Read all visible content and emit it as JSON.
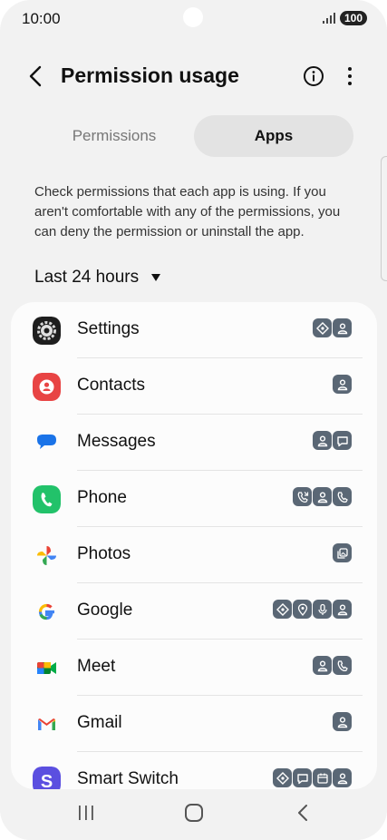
{
  "status": {
    "time": "10:00",
    "battery": "100"
  },
  "appbar": {
    "title": "Permission usage"
  },
  "tabs": [
    {
      "label": "Permissions"
    },
    {
      "label": "Apps"
    }
  ],
  "description": "Check permissions that each app is using. If you aren't comfortable with any of the permissions, you can deny the permission or uninstall the app.",
  "filter": {
    "label": "Last 24 hours"
  },
  "apps": [
    {
      "name": "Settings",
      "perms": [
        "location-icon",
        "contacts-icon"
      ]
    },
    {
      "name": "Contacts",
      "perms": [
        "contacts-icon"
      ]
    },
    {
      "name": "Messages",
      "perms": [
        "contacts-icon",
        "sms-icon"
      ]
    },
    {
      "name": "Phone",
      "perms": [
        "call-log-icon",
        "contacts-icon",
        "phone-icon"
      ]
    },
    {
      "name": "Photos",
      "perms": [
        "media-icon"
      ]
    },
    {
      "name": "Google",
      "perms": [
        "location-icon",
        "location-pin-icon",
        "microphone-icon",
        "contacts-icon"
      ]
    },
    {
      "name": "Meet",
      "perms": [
        "contacts-icon",
        "phone-icon"
      ]
    },
    {
      "name": "Gmail",
      "perms": [
        "contacts-icon"
      ]
    },
    {
      "name": "Smart Switch",
      "perms": [
        "location-icon",
        "sms-icon",
        "calendar-icon",
        "contacts-icon"
      ]
    }
  ],
  "colors": {
    "accent": "#111111",
    "permission_chip": "#5a6775",
    "background": "#f2f2f2"
  }
}
